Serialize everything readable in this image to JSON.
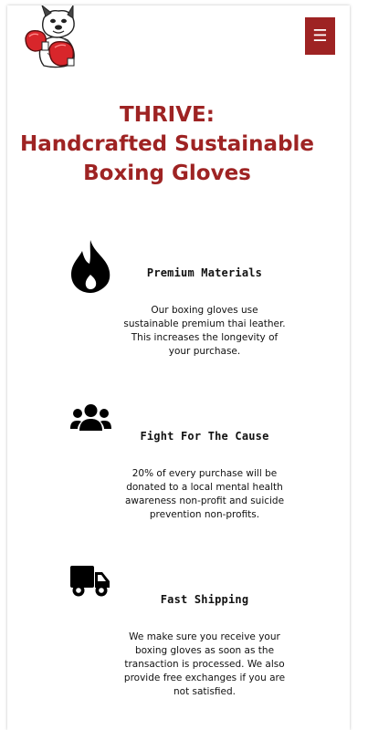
{
  "header": {
    "menu_label": "☰"
  },
  "hero": {
    "title_line1": "THRIVE:",
    "title_line2": "Handcrafted Sustainable",
    "title_line3": "Boxing Gloves"
  },
  "features": [
    {
      "icon": "fire-icon",
      "title": "Premium Materials",
      "description": "Our boxing gloves use sustainable premium thai leather. This increases the longevity of your purchase."
    },
    {
      "icon": "users-icon",
      "title": "Fight For The Cause",
      "description": "20% of every purchase will be donated to a local mental health awareness non-profit and suicide prevention non-profits."
    },
    {
      "icon": "truck-icon",
      "title": "Fast Shipping",
      "description": "We make sure you receive your boxing gloves as soon as the transaction is processed. We also provide free exchanges if you are not satisfied."
    }
  ],
  "colors": {
    "brand": "#9e2323",
    "text": "#111111"
  }
}
